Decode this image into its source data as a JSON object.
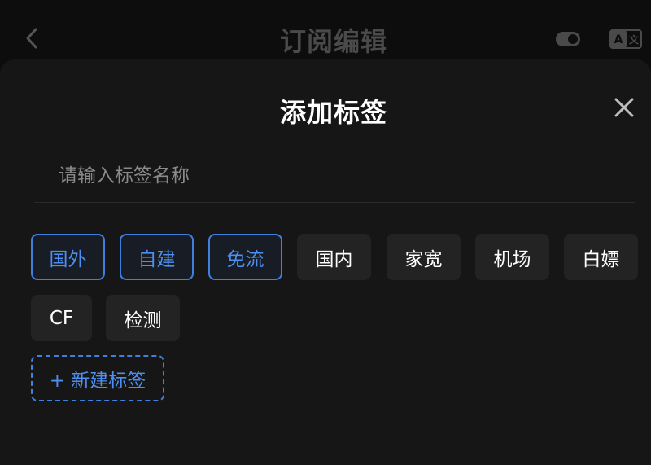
{
  "background_header": {
    "title": "订阅编辑",
    "back_icon": "chevron-left-icon",
    "toggle_icon": "toggle-icon",
    "translate_icon": "translate-icon"
  },
  "sheet": {
    "title": "添加标签",
    "close_icon": "close-icon",
    "input": {
      "placeholder": "请输入标签名称",
      "value": ""
    },
    "tags": [
      {
        "label": "国外",
        "selected": true
      },
      {
        "label": "自建",
        "selected": true
      },
      {
        "label": "免流",
        "selected": true
      },
      {
        "label": "国内",
        "selected": false
      },
      {
        "label": "家宽",
        "selected": false
      },
      {
        "label": "机场",
        "selected": false
      },
      {
        "label": "白嫖",
        "selected": false
      },
      {
        "label": "CF",
        "selected": false
      },
      {
        "label": "检测",
        "selected": false
      }
    ],
    "new_tag_label": "+ 新建标签"
  },
  "colors": {
    "accent": "#3f7fe0",
    "accent_text": "#4d8ff0",
    "sheet_bg": "#161616",
    "tag_bg": "#232323"
  }
}
